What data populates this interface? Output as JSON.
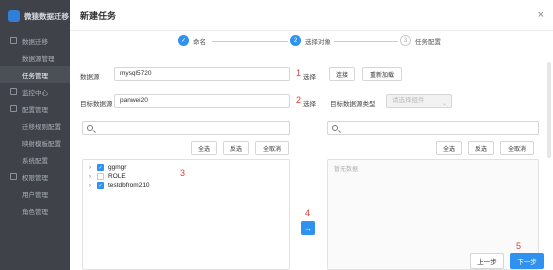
{
  "sidebar": {
    "brand": "微猿数据迁移",
    "items": [
      {
        "label": "数据迁移",
        "type": "group"
      },
      {
        "label": "数据源管理",
        "type": "sub"
      },
      {
        "label": "任务管理",
        "type": "sub",
        "active": true
      },
      {
        "label": "监控中心",
        "type": "group"
      },
      {
        "label": "配置管理",
        "type": "group"
      },
      {
        "label": "迁移规则配置",
        "type": "sub"
      },
      {
        "label": "映射模板配置",
        "type": "sub"
      },
      {
        "label": "系统配置",
        "type": "sub"
      },
      {
        "label": "权限管理",
        "type": "group"
      },
      {
        "label": "用户管理",
        "type": "sub"
      },
      {
        "label": "角色管理",
        "type": "sub"
      }
    ]
  },
  "modal": {
    "title": "新建任务",
    "close": "×"
  },
  "steps": [
    {
      "label": "命名",
      "state": "done",
      "num": "✓"
    },
    {
      "label": "选择对象",
      "state": "current",
      "num": "2"
    },
    {
      "label": "任务配置",
      "state": "todo",
      "num": "3"
    }
  ],
  "form": {
    "source_label": "数据源",
    "source_value": "mysql5720",
    "source_annot": "1",
    "source_select": "选择",
    "connect": "连接",
    "reload": "重新加载",
    "target_label": "目标数据源",
    "target_value": "panwei20",
    "target_annot": "2",
    "target_select": "选择",
    "target_type_label": "目标数据源类型",
    "target_type_placeholder": "请选择组件"
  },
  "left_panel": {
    "select_all": "全选",
    "invert": "反选",
    "deselect": "全取消",
    "annot": "3",
    "items": [
      {
        "label": "ggmgr",
        "checked": true
      },
      {
        "label": "ROLE",
        "checked": false
      },
      {
        "label": "testdbfrom210",
        "checked": true
      }
    ]
  },
  "right_panel": {
    "select_all": "全选",
    "invert": "反选",
    "deselect": "全取消",
    "empty": "暂无数据"
  },
  "transfer": {
    "annot": "4",
    "arrow": "→"
  },
  "footer": {
    "prev": "上一步",
    "next": "下一步",
    "annot": "5"
  }
}
